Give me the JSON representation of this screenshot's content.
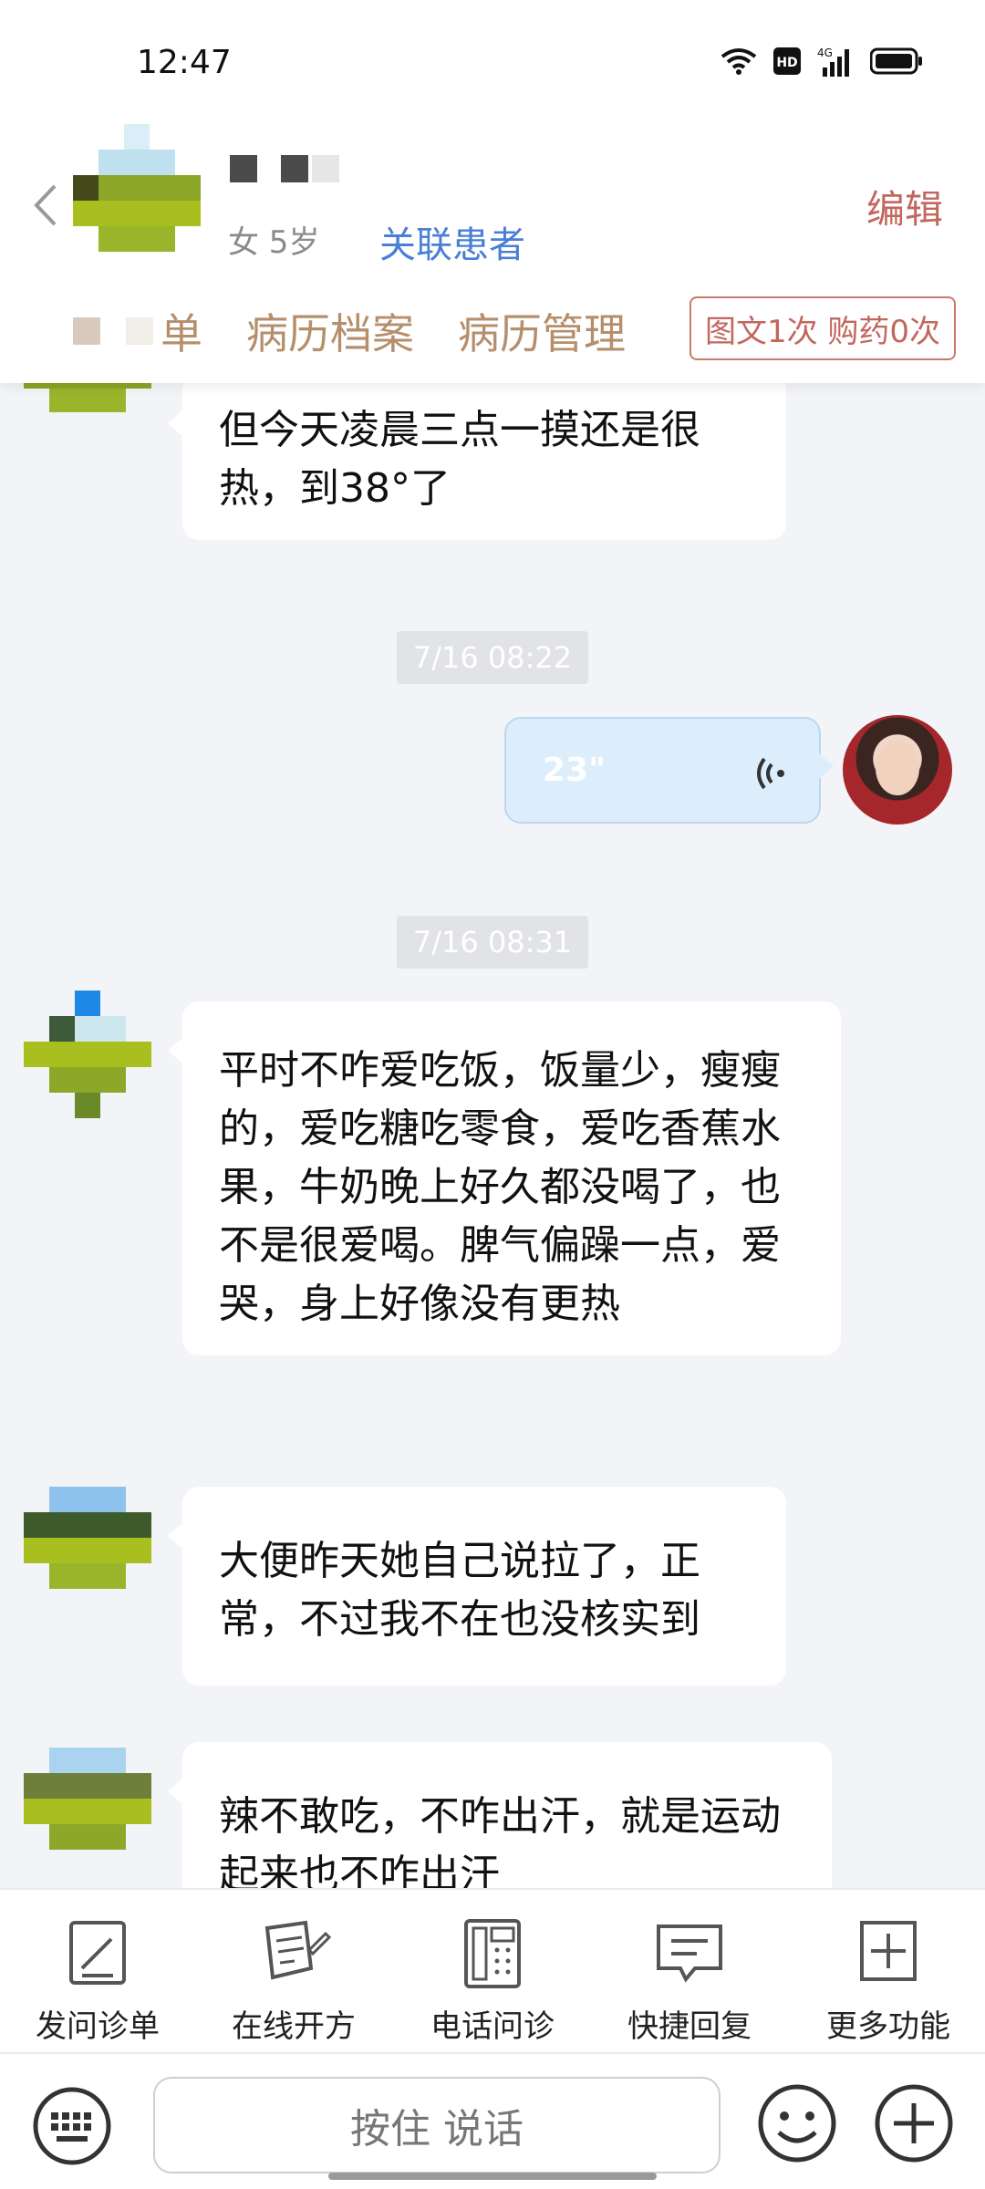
{
  "status_bar": {
    "time": "12:47",
    "network": "4G"
  },
  "header": {
    "patient_meta": "女 5岁",
    "link_patient_label": "关联患者",
    "edit_label": "编辑",
    "tabs": [
      {
        "label": "单"
      },
      {
        "label": "病历档案"
      },
      {
        "label": "病历管理"
      }
    ],
    "stats_badge": "图文1次 购药0次"
  },
  "chat": {
    "messages": [
      {
        "text": "但今天凌晨三点一摸还是很热，到38°了"
      },
      {
        "timestamp": "7/16 08:22"
      },
      {
        "voice_duration": "23\""
      },
      {
        "timestamp": "7/16 08:31"
      },
      {
        "text": "平时不咋爱吃饭，饭量少，瘦瘦的，爱吃糖吃零食，爱吃香蕉水果，牛奶晚上好久都没喝了，也不是很爱喝。脾气偏躁一点，爱哭，身上好像没有更热"
      },
      {
        "text": "大便昨天她自己说拉了，正常，不过我不在也没核实到"
      },
      {
        "text": "辣不敢吃，不咋出汗，就是运动起来也不咋出汗"
      }
    ]
  },
  "toolbar": {
    "items": [
      {
        "label": "发问诊单",
        "icon": "form-icon"
      },
      {
        "label": "在线开方",
        "icon": "prescription-icon"
      },
      {
        "label": "电话问诊",
        "icon": "phone-icon"
      },
      {
        "label": "快捷回复",
        "icon": "quick-reply-icon"
      },
      {
        "label": "更多功能",
        "icon": "more-icon"
      }
    ]
  },
  "input_bar": {
    "hold_to_talk": "按住 说话"
  },
  "colors": {
    "accent_brown": "#b58f6c",
    "edit_red": "#c2675e",
    "link_blue": "#4a7fd6",
    "voice_bubble": "#dcedfb"
  }
}
